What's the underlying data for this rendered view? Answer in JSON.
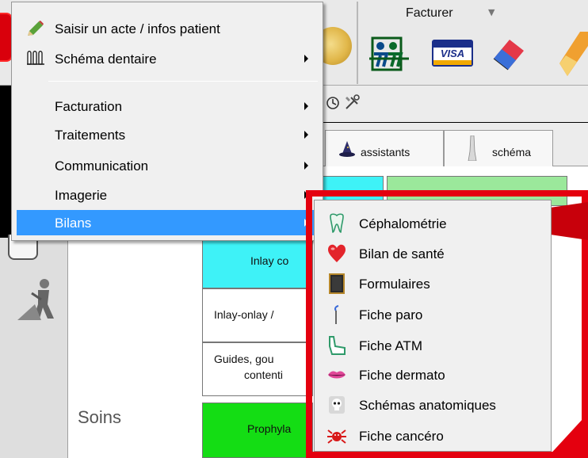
{
  "toolbar": {
    "facturer_label": "Facturer",
    "visa_text": "VISA"
  },
  "tabs": [
    {
      "label": "assistants",
      "icon": "wizard-hat-icon"
    },
    {
      "label": "schéma",
      "icon": "tooth-icon"
    }
  ],
  "soins": {
    "section_label": "Soins",
    "cells": [
      {
        "text": "Inlay co",
        "color": "#3ef2f7"
      },
      {
        "text": "Inlay-onlay /",
        "color": "#ffffff"
      },
      {
        "text_line1": "Guides, gou",
        "text_line2": "contenti",
        "color": "#ffffff"
      },
      {
        "text": "Prophyla",
        "color": "#14dd14"
      }
    ]
  },
  "context_menu": {
    "items": [
      {
        "label": "Saisir un acte / infos patient",
        "icon": "pencil-icon",
        "has_submenu": false
      },
      {
        "label": "Schéma dentaire",
        "icon": "teeth-icon",
        "has_submenu": true
      },
      {
        "label": "Facturation",
        "has_submenu": true
      },
      {
        "label": "Traitements",
        "has_submenu": true
      },
      {
        "label": "Communication",
        "has_submenu": true
      },
      {
        "label": "Imagerie",
        "has_submenu": true
      },
      {
        "label": "Bilans",
        "has_submenu": true,
        "highlighted": true
      }
    ]
  },
  "bilans_submenu": {
    "items": [
      {
        "label": "Céphalométrie",
        "icon": "tooth-outline-icon"
      },
      {
        "label": "Bilan de santé",
        "icon": "heart-icon"
      },
      {
        "label": "Formulaires",
        "icon": "form-book-icon"
      },
      {
        "label": "Fiche paro",
        "icon": "probe-icon"
      },
      {
        "label": "Fiche ATM",
        "icon": "jaw-icon"
      },
      {
        "label": "Fiche dermato",
        "icon": "lips-icon"
      },
      {
        "label": "Schémas anatomiques",
        "icon": "skull-icon"
      },
      {
        "label": "Fiche cancéro",
        "icon": "crab-icon"
      }
    ]
  },
  "colors": {
    "highlight": "#3399ff",
    "callout_red": "#e4000f",
    "menu_bg": "#f0f0f0"
  }
}
